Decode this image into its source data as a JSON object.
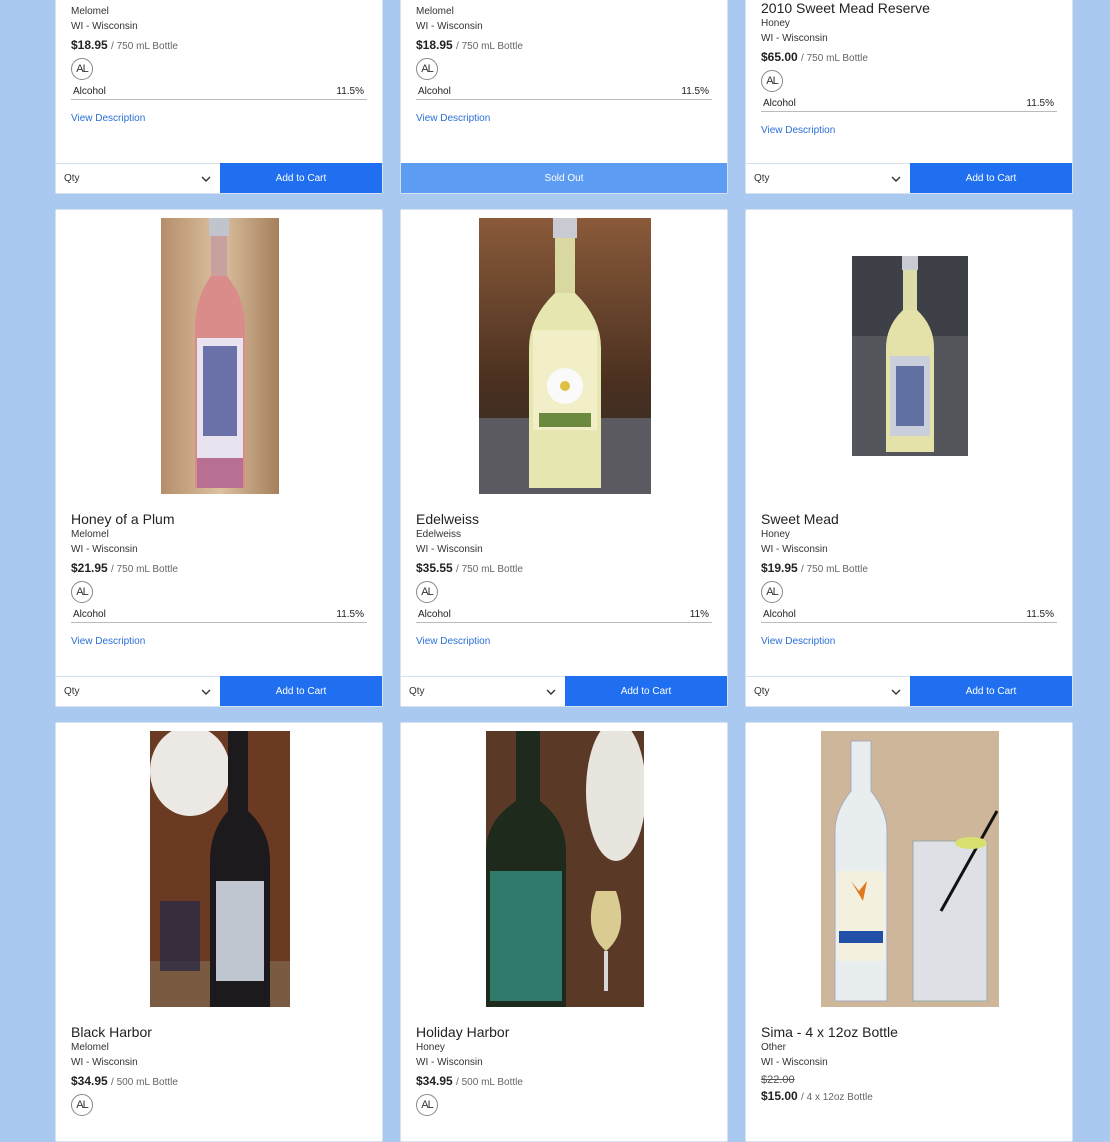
{
  "qty_label": "Qty",
  "add_to_cart": "Add to Cart",
  "sold_out": "Sold Out",
  "view_description": "View Description",
  "alcohol_label": "Alcohol",
  "badge_text": "AL",
  "accent_color": "#1f6ff0",
  "products": [
    {
      "name": "",
      "type": "Melomel",
      "region": "WI - Wisconsin",
      "price": "$18.95",
      "unit": "/ 750 mL Bottle",
      "alcohol": "11.5%"
    },
    {
      "name": "",
      "type": "Melomel",
      "region": "WI - Wisconsin",
      "price": "$18.95",
      "unit": "/ 750 mL Bottle",
      "alcohol": "11.5%"
    },
    {
      "name": "2010 Sweet Mead Reserve",
      "type": "Honey",
      "region": "WI - Wisconsin",
      "price": "$65.00",
      "unit": "/ 750 mL Bottle",
      "alcohol": "11.5%"
    },
    {
      "name": "Honey of a Plum",
      "type": "Melomel",
      "region": "WI - Wisconsin",
      "price": "$21.95",
      "unit": "/ 750 mL Bottle",
      "alcohol": "11.5%"
    },
    {
      "name": "Edelweiss",
      "type": "Edelweiss",
      "region": "WI - Wisconsin",
      "price": "$35.55",
      "unit": "/ 750 mL Bottle",
      "alcohol": "11%"
    },
    {
      "name": "Sweet Mead",
      "type": "Honey",
      "region": "WI - Wisconsin",
      "price": "$19.95",
      "unit": "/ 750 mL Bottle",
      "alcohol": "11.5%"
    },
    {
      "name": "Black Harbor",
      "type": "Melomel",
      "region": "WI - Wisconsin",
      "price": "$34.95",
      "unit": "/ 500 mL Bottle"
    },
    {
      "name": "Holiday Harbor",
      "type": "Honey",
      "region": "WI - Wisconsin",
      "price": "$34.95",
      "unit": "/ 500 mL Bottle"
    },
    {
      "name": "Sima - 4 x 12oz Bottle",
      "type": "Other",
      "region": "WI - Wisconsin",
      "old_price": "$22.00",
      "price": "$15.00",
      "unit": "/ 4 x 12oz Bottle"
    }
  ]
}
